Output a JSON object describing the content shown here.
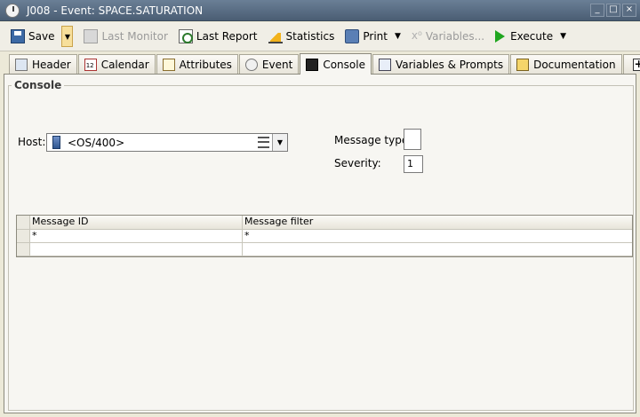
{
  "window": {
    "title": "J008 - Event: SPACE.SATURATION",
    "minimize": "_",
    "restore": "□",
    "close": "×"
  },
  "toolbar": {
    "save": "Save",
    "last_monitor": "Last Monitor",
    "last_report": "Last Report",
    "statistics": "Statistics",
    "print": "Print",
    "variables": "Variables...",
    "execute": "Execute"
  },
  "tabs": [
    {
      "label": "Header",
      "icon": "header-icon"
    },
    {
      "label": "Calendar",
      "icon": "calendar-icon"
    },
    {
      "label": "Attributes",
      "icon": "attributes-icon"
    },
    {
      "label": "Event",
      "icon": "event-icon"
    },
    {
      "label": "Console",
      "icon": "console-icon",
      "active": true
    },
    {
      "label": "Variables & Prompts",
      "icon": "variables-icon"
    },
    {
      "label": "Documentation",
      "icon": "documentation-icon"
    }
  ],
  "console": {
    "group_title": "Console",
    "host_label": "Host:",
    "host_value": "<OS/400>",
    "message_type_label": "Message type:",
    "message_type_value": "",
    "severity_label": "Severity:",
    "severity_value": "1",
    "table": {
      "columns": [
        "Message ID",
        "Message filter"
      ],
      "rows": [
        [
          "*",
          "*"
        ],
        [
          "",
          ""
        ]
      ]
    }
  }
}
